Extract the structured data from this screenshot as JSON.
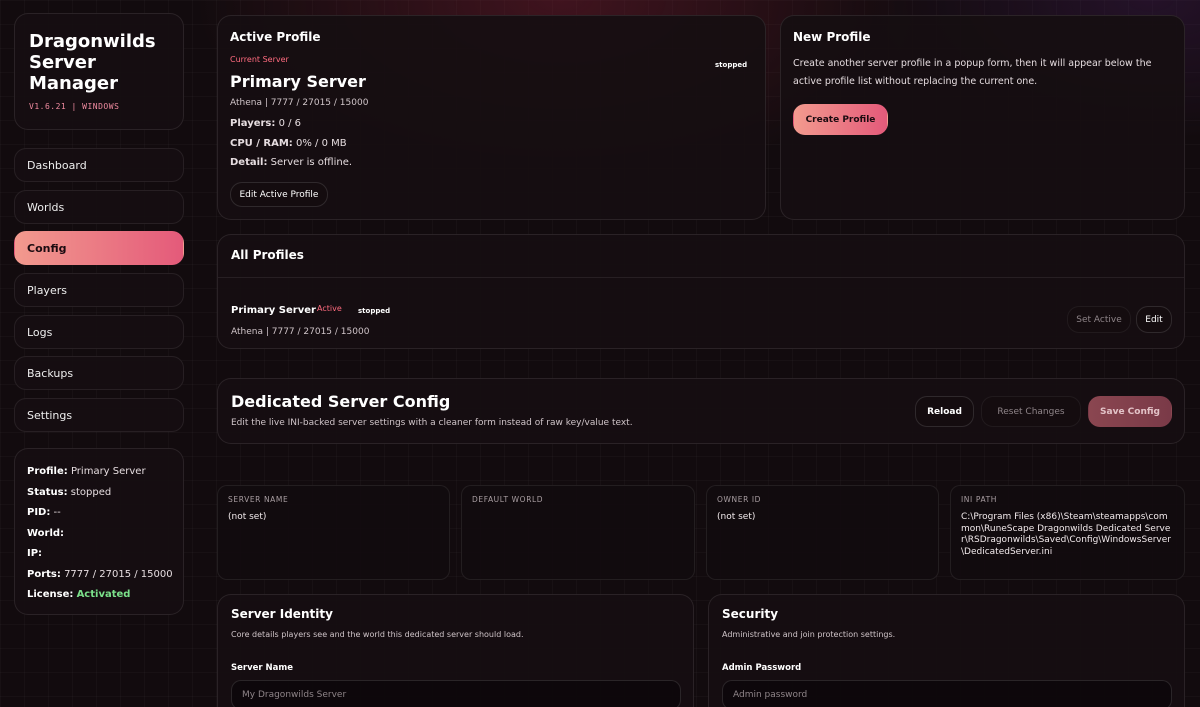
{
  "brand": {
    "title": "Dragonwilds Server Manager",
    "version": "V1.6.21 | WINDOWS"
  },
  "nav": {
    "dashboard": "Dashboard",
    "worlds": "Worlds",
    "config": "Config",
    "players": "Players",
    "logs": "Logs",
    "backups": "Backups",
    "settings": "Settings"
  },
  "status": {
    "profile_label": "Profile:",
    "profile": "Primary Server",
    "status_label": "Status:",
    "status": "stopped",
    "pid_label": "PID:",
    "pid": "--",
    "world_label": "World:",
    "world": "",
    "ip_label": "IP:",
    "ip": "",
    "ports_label": "Ports:",
    "ports": "7777 / 27015 / 15000",
    "license_label": "License:",
    "license": "Activated"
  },
  "active_profile": {
    "heading": "Active Profile",
    "current_label": "Current Server",
    "name": "Primary Server",
    "state": "stopped",
    "ports": "Athena | 7777 / 27015 / 15000",
    "players_label": "Players:",
    "players": "0 / 6",
    "cpu_label": "CPU / RAM:",
    "cpu": "0% / 0 MB",
    "detail_label": "Detail:",
    "detail": "Server is offline.",
    "edit_button": "Edit Active Profile"
  },
  "new_profile": {
    "heading": "New Profile",
    "description": "Create another server profile in a popup form, then it will appear below the active profile list without replacing the current one.",
    "create_button": "Create Profile"
  },
  "all_profiles": {
    "heading": "All Profiles",
    "items": [
      {
        "name": "Primary Server",
        "tag": "Active",
        "state": "stopped",
        "ports": "Athena | 7777 / 27015 / 15000",
        "set_active": "Set Active",
        "edit": "Edit"
      }
    ]
  },
  "dedicated": {
    "heading": "Dedicated Server Config",
    "description": "Edit the live INI-backed server settings with a cleaner form instead of raw key/value text.",
    "reload": "Reload",
    "reset": "Reset Changes",
    "save": "Save Config"
  },
  "cells": {
    "server_name_label": "SERVER NAME",
    "server_name": "(not set)",
    "default_world_label": "DEFAULT WORLD",
    "default_world": "",
    "owner_id_label": "OWNER ID",
    "owner_id": "(not set)",
    "ini_path_label": "INI PATH",
    "ini_path": "C:\\Program Files (x86)\\Steam\\steamapps\\common\\RuneScape Dragonwilds Dedicated Server\\RSDragonwilds\\Saved\\Config\\WindowsServer\\DedicatedServer.ini"
  },
  "identity": {
    "heading": "Server Identity",
    "description": "Core details players see and the world this dedicated server should load.",
    "field_label": "Server Name",
    "field_placeholder": "My Dragonwilds Server"
  },
  "security": {
    "heading": "Security",
    "description": "Administrative and join protection settings.",
    "field_label": "Admin Password",
    "field_placeholder": "Admin password"
  },
  "colors": {
    "accent_start": "#f29a8e",
    "accent_end": "#e45a7a",
    "danger": "#ff6b7f",
    "success": "#7be08a"
  }
}
